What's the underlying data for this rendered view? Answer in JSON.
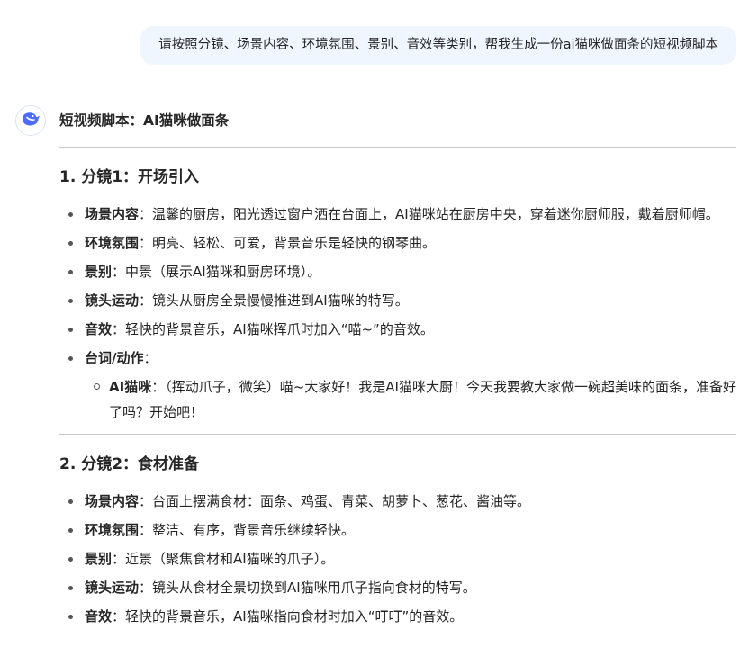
{
  "user_message": "请按照分镜、场景内容、环境氛围、景别、音效等类别，帮我生成一份ai猫咪做面条的短视频脚本",
  "assistant": {
    "avatar_icon": "deepseek-whale-icon",
    "accent_color": "#4d6bfe",
    "title": "短视频脚本：AI猫咪做面条",
    "sections": [
      {
        "heading": "1. 分镜1：开场引入",
        "items": [
          {
            "label": "场景内容",
            "text": "：温馨的厨房，阳光透过窗户洒在台面上，AI猫咪站在厨房中央，穿着迷你厨师服，戴着厨师帽。"
          },
          {
            "label": "环境氛围",
            "text": "：明亮、轻松、可爱，背景音乐是轻快的钢琴曲。"
          },
          {
            "label": "景别",
            "text": "：中景（展示AI猫咪和厨房环境）。"
          },
          {
            "label": "镜头运动",
            "text": "：镜头从厨房全景慢慢推进到AI猫咪的特写。"
          },
          {
            "label": "音效",
            "text": "：轻快的背景音乐，AI猫咪挥爪时加入“喵~”的音效。"
          },
          {
            "label": "台词/动作",
            "text": "："
          }
        ],
        "dialogue": {
          "label": "AI猫咪",
          "text": "：（挥动爪子，微笑）喵~大家好！我是AI猫咪大厨！今天我要教大家做一碗超美味的面条，准备好了吗？开始吧！"
        }
      },
      {
        "heading": "2. 分镜2：食材准备",
        "items": [
          {
            "label": "场景内容",
            "text": "：台面上摆满食材：面条、鸡蛋、青菜、胡萝卜、葱花、酱油等。"
          },
          {
            "label": "环境氛围",
            "text": "：整洁、有序，背景音乐继续轻快。"
          },
          {
            "label": "景别",
            "text": "：近景（聚焦食材和AI猫咪的爪子）。"
          },
          {
            "label": "镜头运动",
            "text": "：镜头从食材全景切换到AI猫咪用爪子指向食材的特写。"
          },
          {
            "label": "音效",
            "text": "：轻快的背景音乐，AI猫咪指向食材时加入“叮叮”的音效。"
          }
        ]
      }
    ]
  }
}
